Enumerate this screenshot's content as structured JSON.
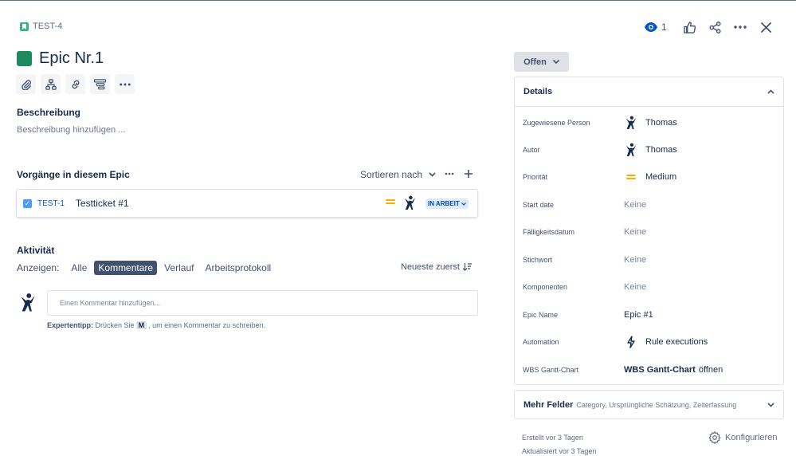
{
  "issue": {
    "key": "TEST-4",
    "title": "Epic Nr.1",
    "watch_count": "1"
  },
  "description": {
    "label": "Beschreibung",
    "placeholder": "Beschreibung hinzufügen ..."
  },
  "child_issues": {
    "label": "Vorgänge in diesem Epic",
    "sort_label": "Sortieren nach",
    "items": [
      {
        "key": "TEST-1",
        "summary": "Testticket #1",
        "status": "IN ARBEIT"
      }
    ]
  },
  "activity": {
    "label": "Aktivität",
    "show_label": "Anzeigen:",
    "filters": [
      "Alle",
      "Kommentare",
      "Verlauf",
      "Arbeitsprotokoll"
    ],
    "active_filter": "Kommentare",
    "sort": "Neueste zuerst",
    "comment_placeholder": "Einen Kommentar hinzufügen...",
    "tip_bold": "Expertentipp:",
    "tip_before": "Drücken Sie",
    "tip_key": "M",
    "tip_after": ", um einen Kommentar zu schreiben."
  },
  "status_button": "Offen",
  "details": {
    "heading": "Details",
    "fields": [
      {
        "label": "Zugewiesene Person",
        "value": "Thomas"
      },
      {
        "label": "Autor",
        "value": "Thomas"
      },
      {
        "label": "Priorität",
        "value": "Medium"
      },
      {
        "label": "Start date",
        "value": "Keine"
      },
      {
        "label": "Fälligkeitsdatum",
        "value": "Keine"
      },
      {
        "label": "Stichwort",
        "value": "Keine"
      },
      {
        "label": "Komponenten",
        "value": "Keine"
      },
      {
        "label": "Epic Name",
        "value": "Epic #1"
      },
      {
        "label": "Automation",
        "value": "Rule executions"
      },
      {
        "label": "WBS Gantt-Chart",
        "value_bold": "WBS Gantt-Chart",
        "value_rest": "öffnen"
      }
    ]
  },
  "more_fields": {
    "label": "Mehr Felder",
    "sub": "Category, Ursprüngliche Schätzung, Zeiterfassung"
  },
  "meta": {
    "created": "Erstellt vor 3 Tagen",
    "updated": "Aktualisiert vor 3 Tagen",
    "configure": "Konfigurieren"
  },
  "colors": {
    "epic": "#1f8a5b",
    "link": "#0052cc",
    "priority_medium": "#ffab00",
    "active_filter": "#42526e"
  }
}
